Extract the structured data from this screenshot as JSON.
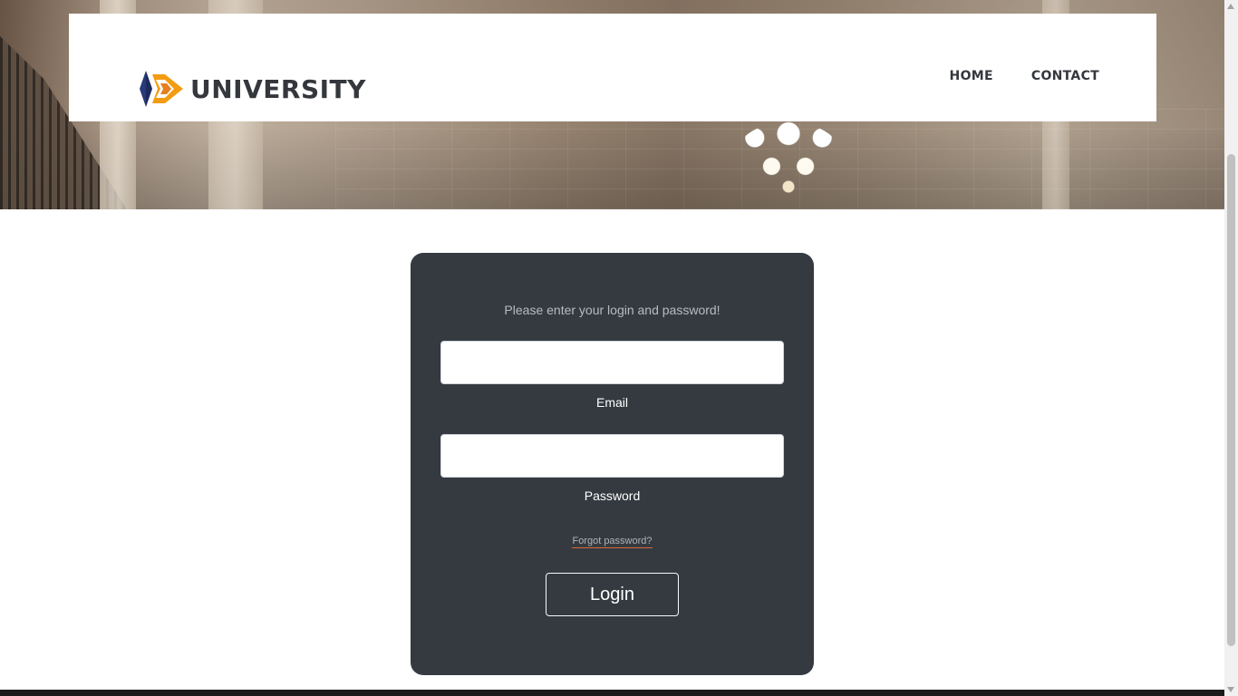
{
  "header": {
    "logo_text": "UNIVERSITY",
    "nav": {
      "home": "HOME",
      "contact": "CONTACT"
    }
  },
  "login": {
    "prompt": "Please enter your login and password!",
    "email": {
      "label": "Email",
      "value": "",
      "placeholder": ""
    },
    "password": {
      "label": "Password",
      "value": "",
      "placeholder": ""
    },
    "forgot_password": "Forgot password?",
    "submit_label": "Login"
  },
  "colors": {
    "card_background": "#343a40",
    "logo_orange": "#f39c12",
    "logo_navy": "#283a7a",
    "text_dark": "#34373c",
    "link_underline": "#e0683a"
  },
  "icons": {
    "logo": "university-logo-icon",
    "scroll_up": "chevron-up-icon",
    "scroll_down": "chevron-down-icon"
  }
}
